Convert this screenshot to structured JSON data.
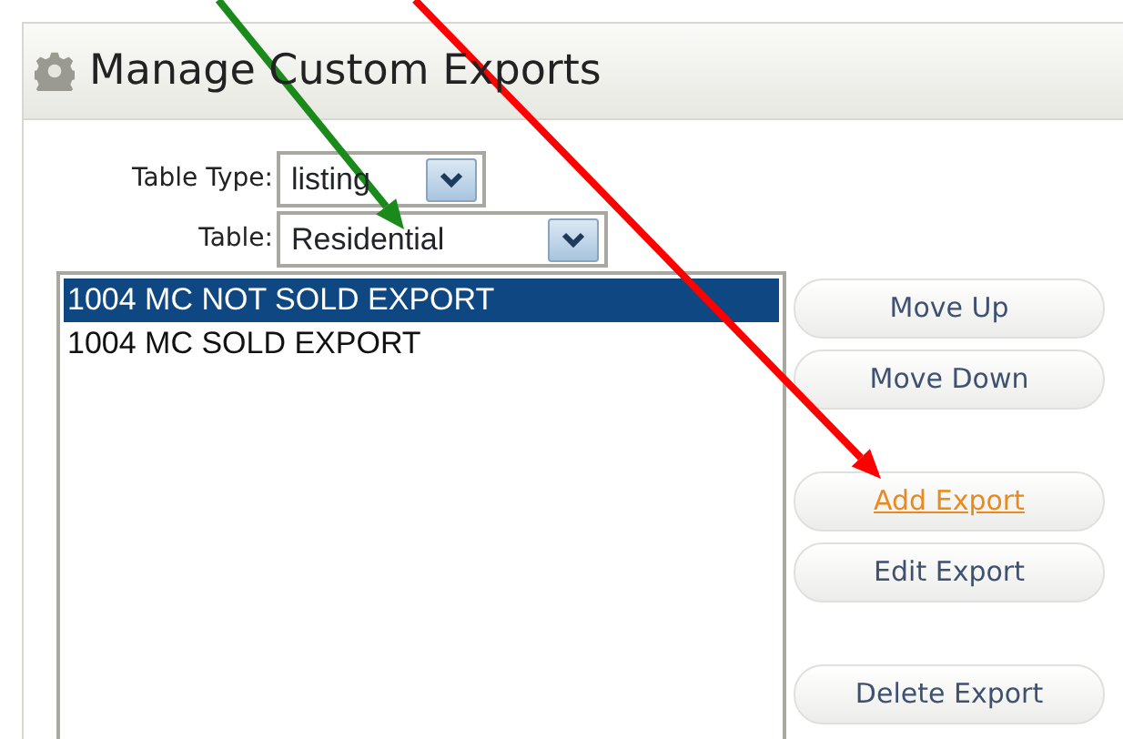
{
  "panel": {
    "title": "Manage Custom Exports"
  },
  "fields": [
    {
      "label": "Table Type:",
      "value": "listing",
      "kind": "short"
    },
    {
      "label": "Table:",
      "value": "Residential",
      "kind": "wide"
    }
  ],
  "exports": [
    {
      "name": "1004 MC NOT SOLD EXPORT",
      "selected": true
    },
    {
      "name": "1004 MC SOLD EXPORT",
      "selected": false
    }
  ],
  "button_groups": [
    {
      "buttons": [
        {
          "label": "Move Up",
          "hovered": false
        },
        {
          "label": "Move Down",
          "hovered": false
        }
      ]
    },
    {
      "buttons": [
        {
          "label": "Add Export",
          "hovered": true
        },
        {
          "label": "Edit Export",
          "hovered": false
        }
      ]
    },
    {
      "buttons": [
        {
          "label": "Delete Export",
          "hovered": false
        }
      ]
    }
  ],
  "arrows": [
    {
      "color": "#1a8a1a"
    },
    {
      "color": "#ff0000"
    }
  ]
}
